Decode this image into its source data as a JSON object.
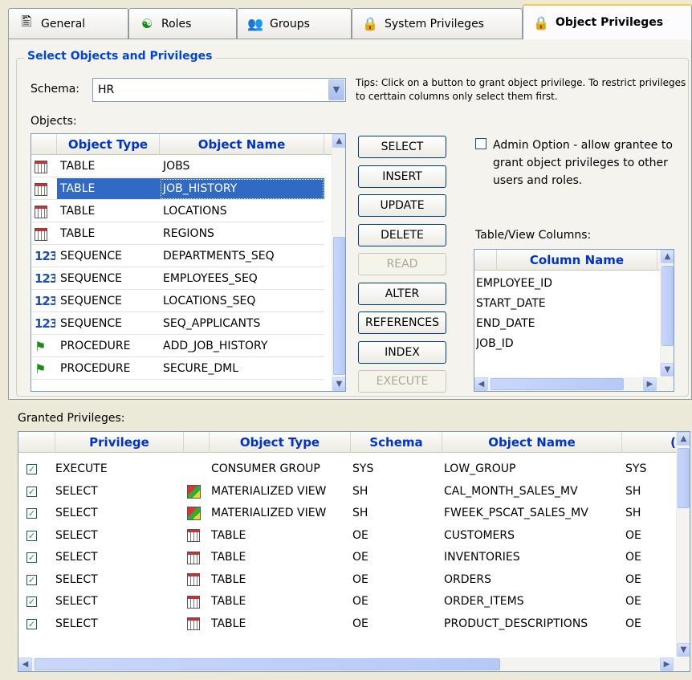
{
  "tabs": [
    {
      "label": "General",
      "icon": "general-properties-icon"
    },
    {
      "label": "Roles",
      "icon": "roles-icon"
    },
    {
      "label": "Groups",
      "icon": "groups-icon"
    },
    {
      "label": "System Privileges",
      "icon": "system-privileges-icon"
    },
    {
      "label": "Object Privileges",
      "icon": "object-privileges-icon",
      "active": true
    }
  ],
  "group_title": "Select Objects and Privileges",
  "schema": {
    "label": "Schema:",
    "value": "HR"
  },
  "tips": "Tips: Click on a button to grant object privilege. To restrict privileges to certtain columns only select them first.",
  "objects": {
    "label": "Objects:",
    "headers": [
      "Object Type",
      "Object Name"
    ],
    "rows": [
      {
        "icon": "table-icon",
        "type": "TABLE",
        "name": "JOBS"
      },
      {
        "icon": "table-icon",
        "type": "TABLE",
        "name": "JOB_HISTORY",
        "selected": true
      },
      {
        "icon": "table-icon",
        "type": "TABLE",
        "name": "LOCATIONS"
      },
      {
        "icon": "table-icon",
        "type": "TABLE",
        "name": "REGIONS"
      },
      {
        "icon": "sequence-icon",
        "type": "SEQUENCE",
        "name": "DEPARTMENTS_SEQ"
      },
      {
        "icon": "sequence-icon",
        "type": "SEQUENCE",
        "name": "EMPLOYEES_SEQ"
      },
      {
        "icon": "sequence-icon",
        "type": "SEQUENCE",
        "name": "LOCATIONS_SEQ"
      },
      {
        "icon": "sequence-icon",
        "type": "SEQUENCE",
        "name": "SEQ_APPLICANTS"
      },
      {
        "icon": "procedure-icon",
        "type": "PROCEDURE",
        "name": "ADD_JOB_HISTORY"
      },
      {
        "icon": "procedure-icon",
        "type": "PROCEDURE",
        "name": "SECURE_DML"
      }
    ]
  },
  "privilege_buttons": [
    {
      "label": "SELECT",
      "enabled": true
    },
    {
      "label": "INSERT",
      "enabled": true
    },
    {
      "label": "UPDATE",
      "enabled": true
    },
    {
      "label": "DELETE",
      "enabled": true
    },
    {
      "label": "READ",
      "enabled": false
    },
    {
      "label": "ALTER",
      "enabled": true
    },
    {
      "label": "REFERENCES",
      "enabled": true
    },
    {
      "label": "INDEX",
      "enabled": true
    },
    {
      "label": "EXECUTE",
      "enabled": false
    }
  ],
  "admin_option": {
    "label": "Admin Option - allow grantee to grant object privileges to other users and roles.",
    "checked": false
  },
  "columns": {
    "label": "Table/View Columns:",
    "header": "Column Name",
    "rows": [
      "EMPLOYEE_ID",
      "START_DATE",
      "END_DATE",
      "JOB_ID"
    ]
  },
  "granted": {
    "label": "Granted Privileges:",
    "headers": [
      "Privilege",
      "Object Type",
      "Schema",
      "Object Name",
      "("
    ],
    "rows": [
      {
        "checked": true,
        "privilege": "EXECUTE",
        "icon": "",
        "type": "CONSUMER GROUP",
        "schema": "SYS",
        "name": "LOW_GROUP",
        "grantor": "SYS"
      },
      {
        "checked": true,
        "privilege": "SELECT",
        "icon": "materialized-view-icon",
        "type": "MATERIALIZED VIEW",
        "schema": "SH",
        "name": "CAL_MONTH_SALES_MV",
        "grantor": "SH"
      },
      {
        "checked": true,
        "privilege": "SELECT",
        "icon": "materialized-view-icon",
        "type": "MATERIALIZED VIEW",
        "schema": "SH",
        "name": "FWEEK_PSCAT_SALES_MV",
        "grantor": "SH"
      },
      {
        "checked": true,
        "privilege": "SELECT",
        "icon": "table-icon",
        "type": "TABLE",
        "schema": "OE",
        "name": "CUSTOMERS",
        "grantor": "OE"
      },
      {
        "checked": true,
        "privilege": "SELECT",
        "icon": "table-icon",
        "type": "TABLE",
        "schema": "OE",
        "name": "INVENTORIES",
        "grantor": "OE"
      },
      {
        "checked": true,
        "privilege": "SELECT",
        "icon": "table-icon",
        "type": "TABLE",
        "schema": "OE",
        "name": "ORDERS",
        "grantor": "OE"
      },
      {
        "checked": true,
        "privilege": "SELECT",
        "icon": "table-icon",
        "type": "TABLE",
        "schema": "OE",
        "name": "ORDER_ITEMS",
        "grantor": "OE"
      },
      {
        "checked": true,
        "privilege": "SELECT",
        "icon": "table-icon",
        "type": "TABLE",
        "schema": "OE",
        "name": "PRODUCT_DESCRIPTIONS",
        "grantor": "OE"
      }
    ]
  }
}
